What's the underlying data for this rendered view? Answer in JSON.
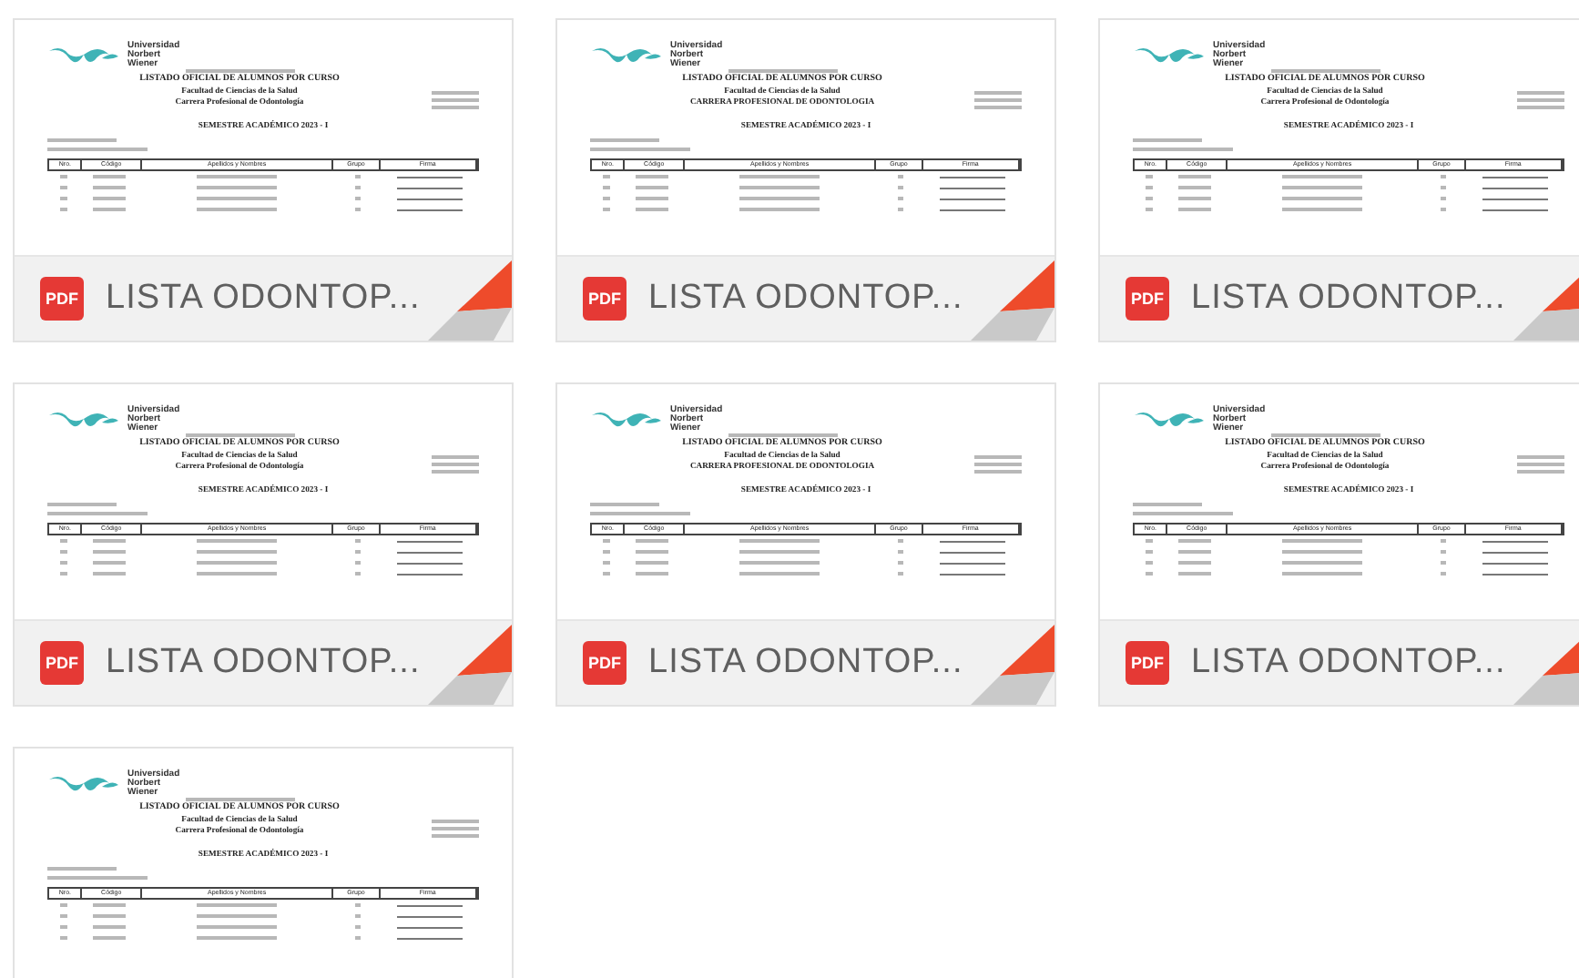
{
  "files": [
    {
      "badge": "PDF",
      "title": "LISTA ODONTOP...",
      "preview": {
        "institution": "Universidad Norbert Wiener",
        "heading": "LISTADO OFICIAL DE ALUMNOS POR CURSO",
        "faculty": "Facultad de Ciencias de la Salud",
        "program": "Carrera Profesional de Odontología",
        "semester": "SEMESTRE ACADÉMICO 2023 - I",
        "columns": [
          "Nro.",
          "Código",
          "Apellidos y Nombres",
          "Grupo",
          "Firma"
        ]
      }
    },
    {
      "badge": "PDF",
      "title": "LISTA ODONTOP...",
      "preview": {
        "institution": "Universidad Norbert Wiener",
        "heading": "LISTADO OFICIAL DE ALUMNOS POR CURSO",
        "faculty": "Facultad de Ciencias de la Salud",
        "program": "CARRERA PROFESIONAL DE ODONTOLOGIA",
        "semester": "SEMESTRE ACADÉMICO 2023 - I",
        "columns": [
          "Nro.",
          "Código",
          "Apellidos y Nombres",
          "Grupo",
          "Firma"
        ]
      }
    },
    {
      "badge": "PDF",
      "title": "LISTA ODONTOP...",
      "preview": {
        "institution": "Universidad Norbert Wiener",
        "heading": "LISTADO OFICIAL DE ALUMNOS POR CURSO",
        "faculty": "Facultad de Ciencias de la Salud",
        "program": "Carrera Profesional de Odontología",
        "semester": "SEMESTRE ACADÉMICO 2023 - I",
        "columns": [
          "Nro.",
          "Código",
          "Apellidos y Nombres",
          "Grupo",
          "Firma"
        ]
      }
    },
    {
      "badge": "PDF",
      "title": "LISTA ODONTOP...",
      "preview": {
        "institution": "Universidad Norbert Wiener",
        "heading": "LISTADO OFICIAL DE ALUMNOS POR CURSO",
        "faculty": "Facultad de Ciencias de la Salud",
        "program": "Carrera Profesional de Odontología",
        "semester": "SEMESTRE ACADÉMICO 2023 - I",
        "columns": [
          "Nro.",
          "Código",
          "Apellidos y Nombres",
          "Grupo",
          "Firma"
        ]
      }
    },
    {
      "badge": "PDF",
      "title": "LISTA ODONTOP...",
      "preview": {
        "institution": "Universidad Norbert Wiener",
        "heading": "LISTADO OFICIAL DE ALUMNOS POR CURSO",
        "faculty": "Facultad de Ciencias de la Salud",
        "program": "CARRERA PROFESIONAL DE ODONTOLOGIA",
        "semester": "SEMESTRE ACADÉMICO 2023 - I",
        "columns": [
          "Nro.",
          "Código",
          "Apellidos y Nombres",
          "Grupo",
          "Firma"
        ]
      }
    },
    {
      "badge": "PDF",
      "title": "LISTA ODONTOP...",
      "preview": {
        "institution": "Universidad Norbert Wiener",
        "heading": "LISTADO OFICIAL DE ALUMNOS POR CURSO",
        "faculty": "Facultad de Ciencias de la Salud",
        "program": "Carrera Profesional de Odontología",
        "semester": "SEMESTRE ACADÉMICO 2023 - I",
        "columns": [
          "Nro.",
          "Código",
          "Apellidos y Nombres",
          "Grupo",
          "Firma"
        ]
      }
    },
    {
      "preview": {
        "institution": "Universidad Norbert Wiener",
        "heading": "LISTADO OFICIAL DE ALUMNOS POR CURSO",
        "faculty": "Facultad de Ciencias de la Salud",
        "program": "Carrera Profesional de Odontología",
        "semester": "SEMESTRE ACADÉMICO 2023 - I",
        "columns": [
          "Nro.",
          "Código",
          "Apellidos y Nombres",
          "Grupo",
          "Firma"
        ]
      }
    }
  ]
}
